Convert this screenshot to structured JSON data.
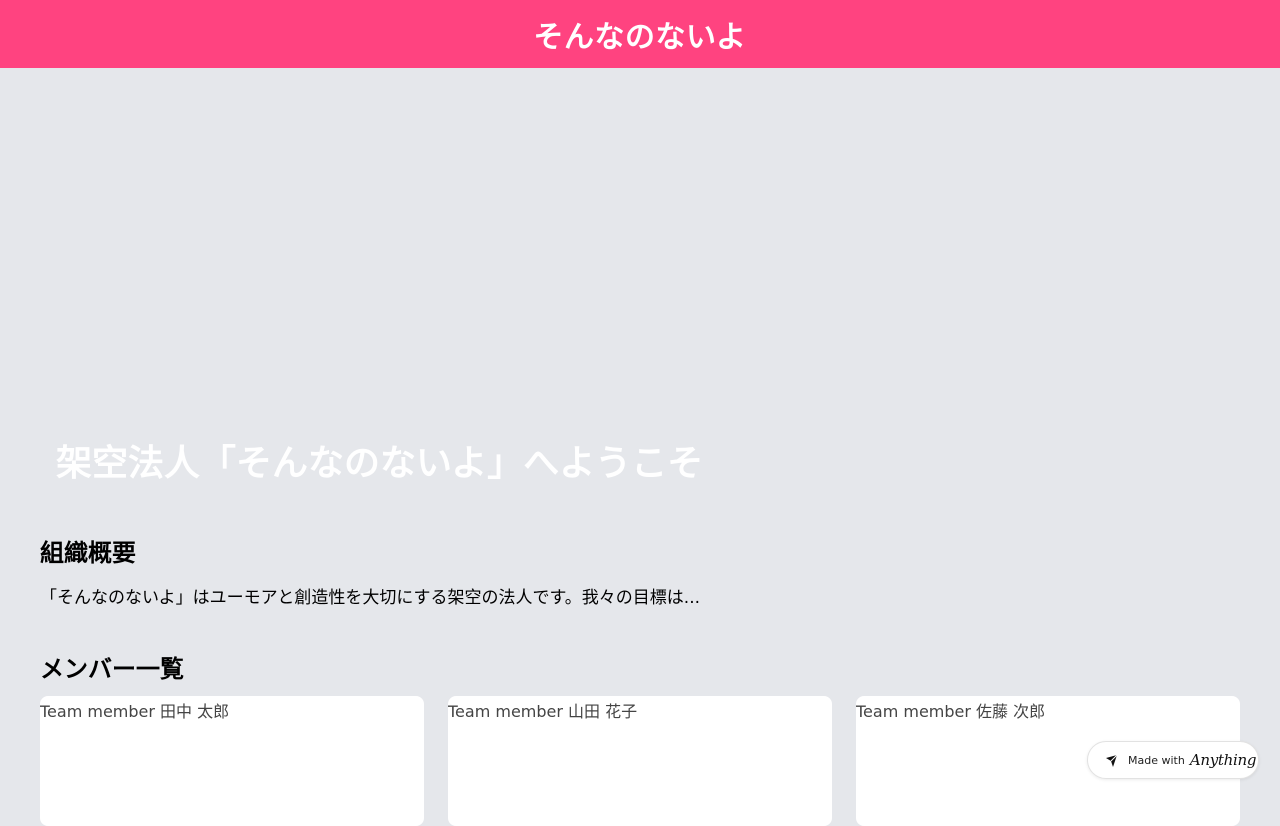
{
  "header": {
    "title": "そんなのないよ"
  },
  "hero": {
    "title": "架空法人「そんなのないよ」へようこそ"
  },
  "about": {
    "heading": "組織概要",
    "text": "「そんなのないよ」はユーモアと創造性を大切にする架空の法人です。我々の目標は..."
  },
  "members": {
    "heading": "メンバー一覧",
    "items": [
      {
        "image_alt": "Team member 田中 太郎"
      },
      {
        "image_alt": "Team member 山田 花子"
      },
      {
        "image_alt": "Team member 佐藤 次郎"
      }
    ]
  },
  "badge": {
    "prefix": "Made with",
    "brand": "Anything",
    "icon": "anything-logo-icon"
  },
  "colors": {
    "header_bg": "#ff4380",
    "page_bg": "#e5e7eb",
    "card_bg": "#ffffff",
    "hero_text": "#ffffff"
  }
}
